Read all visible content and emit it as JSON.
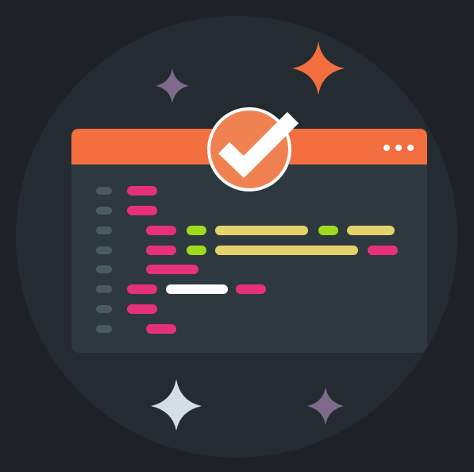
{
  "colors": {
    "background": "#1e2226",
    "circle": "#252c31",
    "window_frame": "#2d393f",
    "window_header": "#f36f3f",
    "check_badge": "#f08252",
    "check_ring": "#ffffff",
    "dot_gutter": "#4b5a61",
    "code_pink": "#e63177",
    "code_green": "#9edb1e",
    "code_yellow": "#e3d36b",
    "code_white": "#ffffff",
    "sparkle_purple": "#7e6b8c",
    "sparkle_orange": "#f36f3f",
    "sparkle_light": "#d3dee7"
  },
  "icons": {
    "header_menu": "ellipsis-icon",
    "badge": "checkmark-icon",
    "sparkles": [
      "sparkle-purple-icon",
      "sparkle-orange-icon",
      "sparkle-light-icon",
      "sparkle-purple-small-icon"
    ]
  },
  "code_lines": [
    {
      "tokens": [
        "pink"
      ]
    },
    {
      "tokens": [
        "pink"
      ]
    },
    {
      "tokens": [
        "pink",
        "green",
        "yellow",
        "green",
        "yellow"
      ]
    },
    {
      "tokens": [
        "pink",
        "green",
        "yellow",
        "pink"
      ]
    },
    {
      "tokens": [
        "pink"
      ]
    },
    {
      "tokens": [
        "pink",
        "white",
        "pink"
      ]
    },
    {
      "tokens": [
        "pink"
      ]
    },
    {
      "tokens": [
        "pink"
      ]
    }
  ]
}
